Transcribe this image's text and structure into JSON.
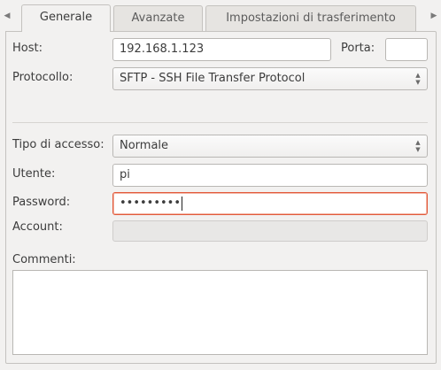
{
  "tabs": [
    {
      "label": "Generale",
      "active": true
    },
    {
      "label": "Avanzate",
      "active": false
    },
    {
      "label": "Impostazioni di trasferimento",
      "active": false
    }
  ],
  "form": {
    "host_label": "Host:",
    "host_value": "192.168.1.123",
    "port_label": "Porta:",
    "port_value": "",
    "protocol_label": "Protocollo:",
    "protocol_value": "SFTP - SSH File Transfer Protocol",
    "access_label": "Tipo di accesso:",
    "access_value": "Normale",
    "user_label": "Utente:",
    "user_value": "pi",
    "password_label": "Password:",
    "password_value": "•••••••••",
    "account_label": "Account:",
    "account_value": "",
    "comments_label": "Commenti:",
    "comments_value": ""
  },
  "icons": {
    "scroll_left": "tab-scroll-left-icon",
    "scroll_right": "tab-scroll-right-icon",
    "spin": "select-spin-icon"
  },
  "colors": {
    "focus_border": "#e25a3b",
    "background": "#f2f1f0"
  }
}
